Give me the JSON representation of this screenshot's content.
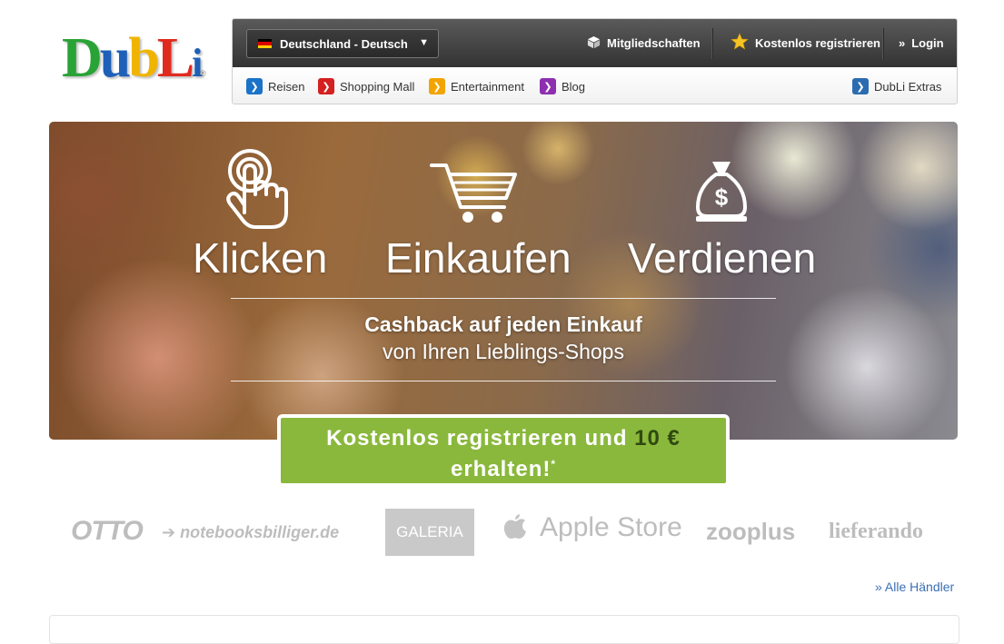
{
  "logo": {
    "letters": [
      "D",
      "u",
      "b",
      "L",
      "i"
    ],
    "colors": [
      "#2aa336",
      "#1e5fb8",
      "#f0b400",
      "#e12a1e",
      "#1e5fb8"
    ],
    "registered": "®"
  },
  "header": {
    "language": {
      "flag_colors": [
        "#000000",
        "#dd0000",
        "#ffce00"
      ],
      "label": "Deutschland - Deutsch",
      "caret": "▼"
    },
    "top_nav": [
      {
        "label": "Mitgliedschaften",
        "icon": "box-icon"
      },
      {
        "label": "Kostenlos registrieren",
        "icon": "star-icon"
      },
      {
        "label": "Login",
        "icon": "double-chevron-icon",
        "glyph": "»"
      }
    ],
    "sub_nav": [
      {
        "label": "Reisen",
        "color": "#1a73c8"
      },
      {
        "label": "Shopping Mall",
        "color": "#d42020"
      },
      {
        "label": "Entertainment",
        "color": "#f2a400"
      },
      {
        "label": "Blog",
        "color": "#8e2fb0"
      },
      {
        "label": "DubLi Extras",
        "color": "#2b6cb0"
      }
    ],
    "chevron_glyph": "❯"
  },
  "hero": {
    "steps": [
      {
        "label": "Klicken",
        "icon": "pointer-hand-icon"
      },
      {
        "label": "Einkaufen",
        "icon": "shopping-cart-icon"
      },
      {
        "label": "Verdienen",
        "icon": "money-bag-icon"
      }
    ],
    "cashback_title": "Cashback auf jeden Einkauf",
    "cashback_sub": "von Ihren Lieblings-Shops"
  },
  "cta": {
    "text_1": "Kostenlos registrieren und ",
    "amount": "10 €",
    "text_2": "erhalten!",
    "footnote": "*"
  },
  "brands": {
    "otto": "OTTO",
    "notebooksbilliger": "notebooksbilliger.de",
    "galeria": "GALERIA",
    "apple": "Apple Store",
    "zooplus": "zooplus",
    "lieferando": "lieferando"
  },
  "all_merchants": "» Alle Händler"
}
